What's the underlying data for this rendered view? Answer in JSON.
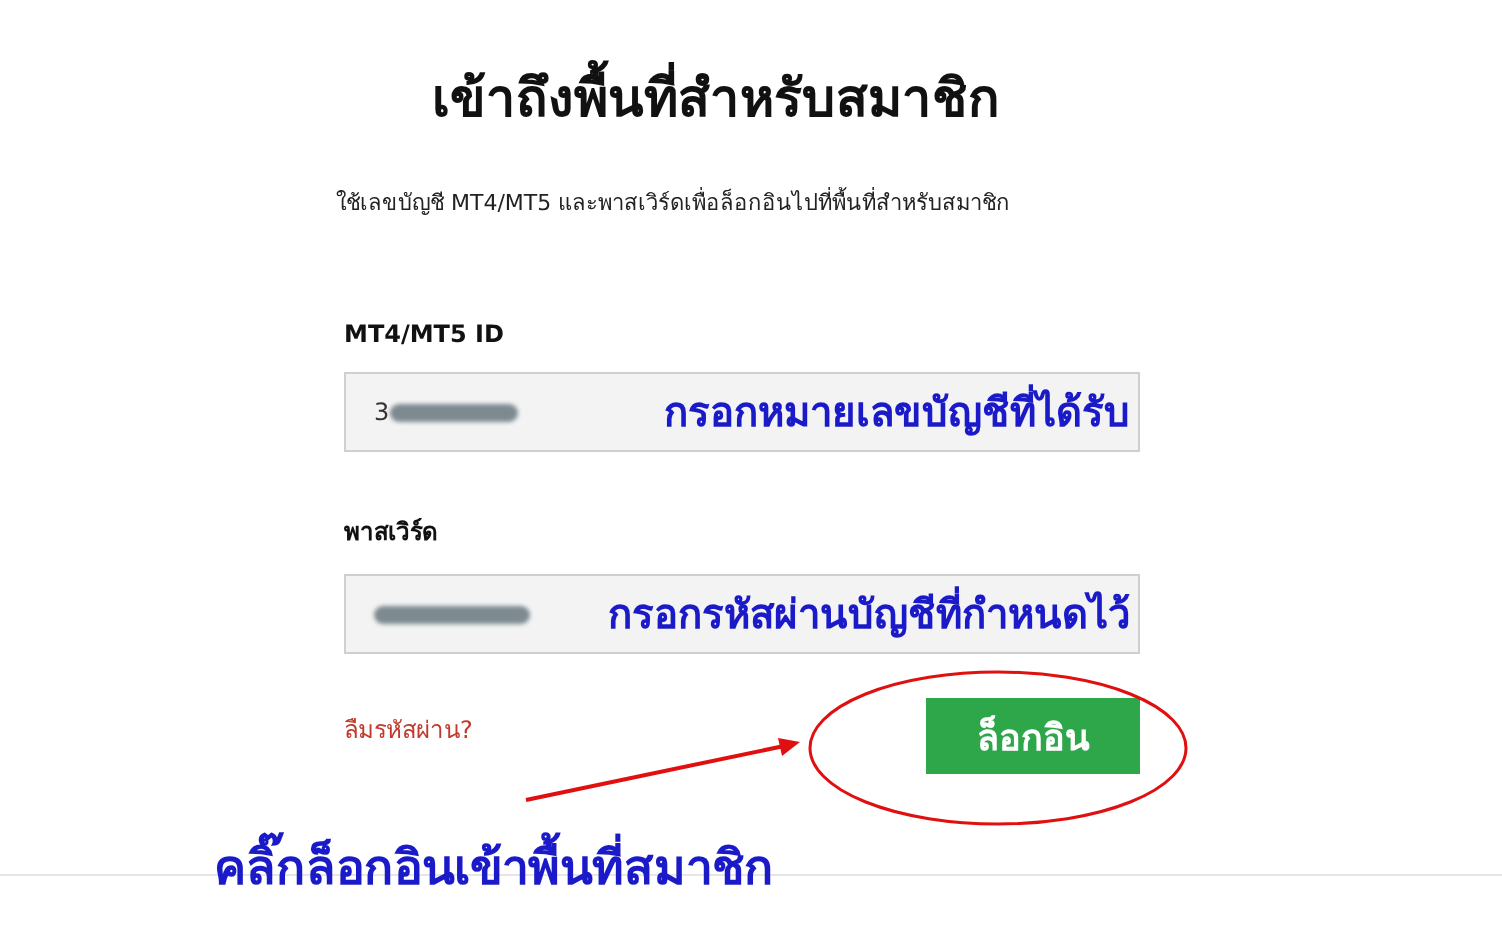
{
  "title": "เข้าถึงพื้นที่สำหรับสมาชิก",
  "subtitle": "ใช้เลขบัญชี MT4/MT5 และพาสเวิร์ดเพื่อล็อกอินไปที่พื้นที่สำหรับสมาชิก",
  "fields": [
    {
      "label": "MT4/MT5 ID",
      "value": "3",
      "annotation": "กรอกหมายเลขบัญชีที่ได้รับ"
    },
    {
      "label": "พาสเวิร์ด",
      "annotation": "กรอกรหัสผ่านบัญชีที่กำหนดไว้"
    }
  ],
  "forgot_link": "ลืมรหัสผ่าน?",
  "login_button": "ล็อกอิน",
  "callout": "คลิ๊กล็อกอินเข้าพื้นที่สมาชิก"
}
